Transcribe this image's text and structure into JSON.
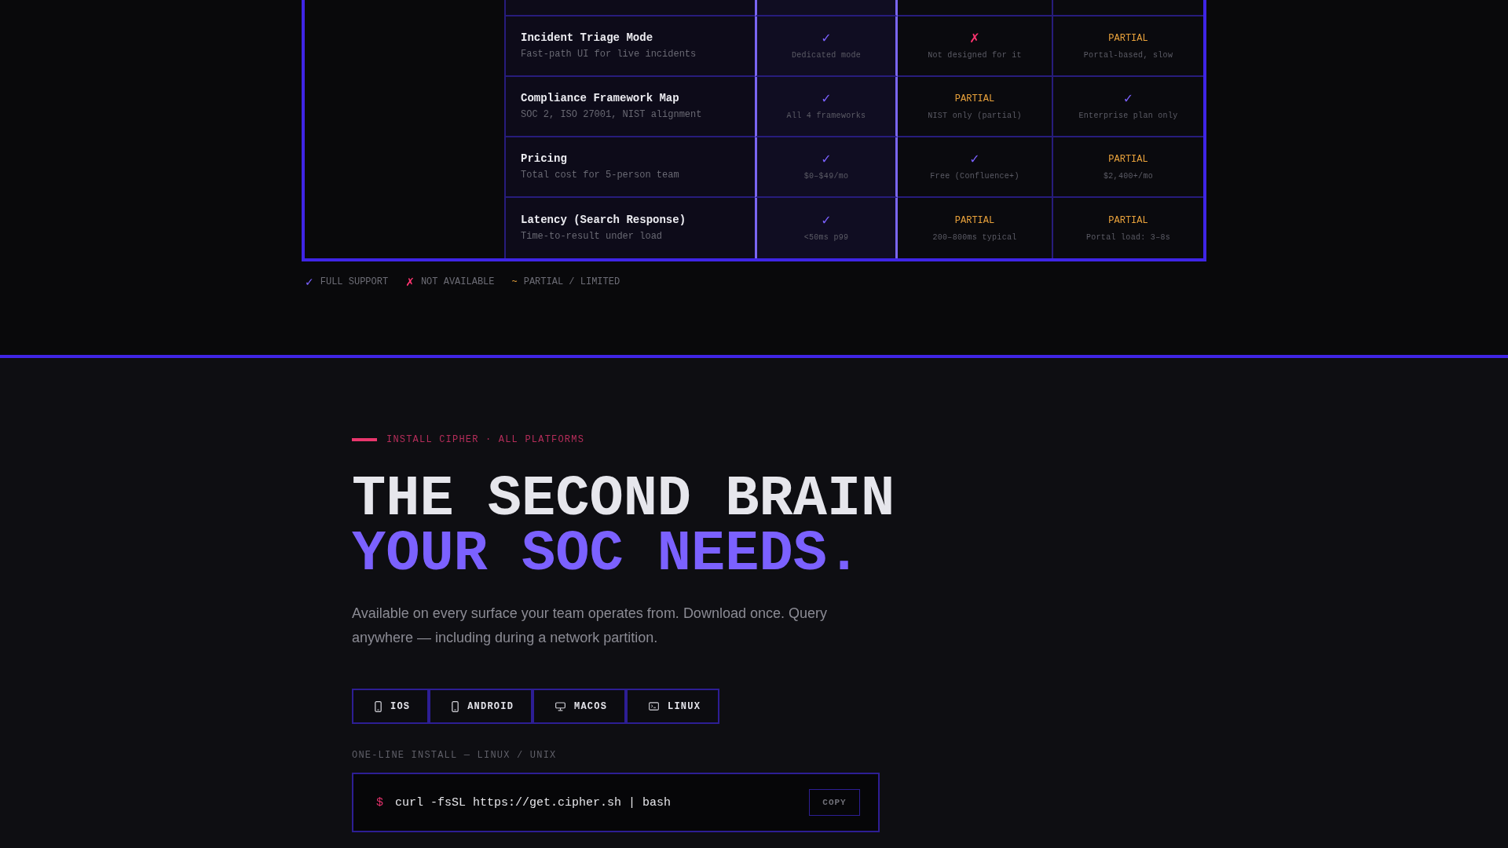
{
  "comparison_table": {
    "rows": [
      {
        "feature": "Incident Triage Mode",
        "description": "Fast-path UI for live incidents",
        "cells": [
          {
            "kind": "full",
            "mark": "✓",
            "note": "Dedicated mode"
          },
          {
            "kind": "none",
            "mark": "✗",
            "note": "Not designed for it"
          },
          {
            "kind": "partial",
            "mark": "PARTIAL",
            "note": "Portal-based, slow"
          }
        ]
      },
      {
        "feature": "Compliance Framework Map",
        "description": "SOC 2, ISO 27001, NIST alignment",
        "cells": [
          {
            "kind": "full",
            "mark": "✓",
            "note": "All 4 frameworks"
          },
          {
            "kind": "partial",
            "mark": "PARTIAL",
            "note": "NIST only (partial)"
          },
          {
            "kind": "full",
            "mark": "✓",
            "note": "Enterprise plan only"
          }
        ]
      },
      {
        "feature": "Pricing",
        "description": "Total cost for 5-person team",
        "cells": [
          {
            "kind": "full",
            "mark": "✓",
            "note": "$0–$49/mo"
          },
          {
            "kind": "full",
            "mark": "✓",
            "note": "Free (Confluence+)"
          },
          {
            "kind": "partial",
            "mark": "PARTIAL",
            "note": "$2,400+/mo"
          }
        ]
      },
      {
        "feature": "Latency (Search Response)",
        "description": "Time-to-result under load",
        "cells": [
          {
            "kind": "full",
            "mark": "✓",
            "note": "<50ms p99"
          },
          {
            "kind": "partial",
            "mark": "PARTIAL",
            "note": "200–800ms typical"
          },
          {
            "kind": "partial",
            "mark": "PARTIAL",
            "note": "Portal load: 3–8s"
          }
        ]
      }
    ]
  },
  "legend": [
    {
      "kind": "full",
      "symbol": "✓",
      "label": "FULL SUPPORT"
    },
    {
      "kind": "none",
      "symbol": "✗",
      "label": "NOT AVAILABLE"
    },
    {
      "kind": "partial",
      "symbol": "~",
      "label": "PARTIAL / LIMITED"
    }
  ],
  "install": {
    "eyebrow": "INSTALL CIPHER · ALL PLATFORMS",
    "headline": [
      {
        "text": "THE SECOND BRAIN",
        "accent": false
      },
      {
        "text": "YOUR SOC NEEDS.",
        "accent": true
      }
    ],
    "intro": "Available on every surface your team operates from. Download once. Query anywhere — including during a network partition.",
    "platforms": [
      {
        "kind": "phone",
        "label": "IOS"
      },
      {
        "kind": "phone",
        "label": "ANDROID"
      },
      {
        "kind": "desktop",
        "label": "MACOS"
      },
      {
        "kind": "terminal",
        "label": "LINUX"
      }
    ],
    "command_label": "ONE-LINE INSTALL — LINUX / UNIX",
    "command": {
      "prompt": "$",
      "text": "curl -fsSL https://get.cipher.sh | bash",
      "copy_button": "COPY"
    }
  }
}
